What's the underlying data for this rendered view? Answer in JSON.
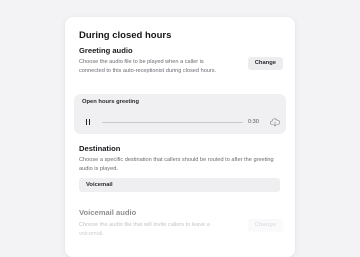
{
  "section_title": "During closed hours",
  "greeting": {
    "heading": "Greeting audio",
    "description": "Choose the audio file to be played when a caller is connected to this auto-receptionist during closed hours.",
    "change_label": "Change",
    "player": {
      "label": "Open hours greeting",
      "time": "0:30",
      "progress_fraction": 0.0,
      "play_icon": "pause-icon",
      "download_icon": "cloud-download-icon"
    }
  },
  "destination": {
    "heading": "Destination",
    "description": "Choose a specific destination that callers should be routed to after the greeting audio is played.",
    "selected": "Voicemail"
  },
  "voicemail": {
    "heading": "Voicemail audio",
    "description": "Choose the audio file that will invite callers to leave a voicemail.",
    "change_label": "Change"
  }
}
